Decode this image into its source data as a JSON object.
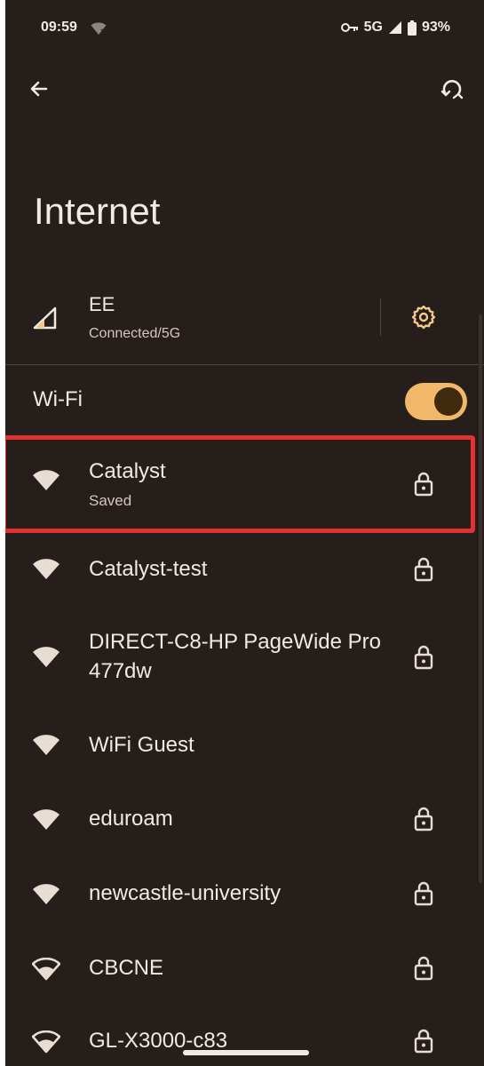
{
  "status_bar": {
    "time": "09:59",
    "network": "5G",
    "battery": "93%",
    "icons": [
      "wifi-unknown-icon",
      "vpn-key-icon",
      "cell-signal-icon",
      "battery-icon"
    ]
  },
  "header": {
    "back_icon": "arrow-back-icon",
    "reset_icon": "network-reset-icon",
    "title": "Internet"
  },
  "carrier": {
    "name": "EE",
    "status": "Connected/5G",
    "icon": "cell-signal-icon",
    "settings_icon": "gear-icon"
  },
  "wifi": {
    "label": "Wi-Fi",
    "enabled": true
  },
  "networks": [
    {
      "name": "Catalyst",
      "subtitle": "Saved",
      "locked": true,
      "highlighted": true
    },
    {
      "name": "Catalyst-test",
      "locked": true
    },
    {
      "name": "DIRECT-C8-HP PageWide Pro 477dw",
      "locked": true
    },
    {
      "name": "WiFi Guest",
      "locked": false
    },
    {
      "name": "eduroam",
      "locked": true
    },
    {
      "name": "newcastle-university",
      "locked": true
    },
    {
      "name": "CBCNE",
      "locked": true
    },
    {
      "name": "GL-X3000-c83",
      "locked": true
    }
  ],
  "colors": {
    "background": "#261e1b",
    "text": "#f2e9e2",
    "accent": "#f2b86a",
    "highlight": "#e4302f"
  }
}
